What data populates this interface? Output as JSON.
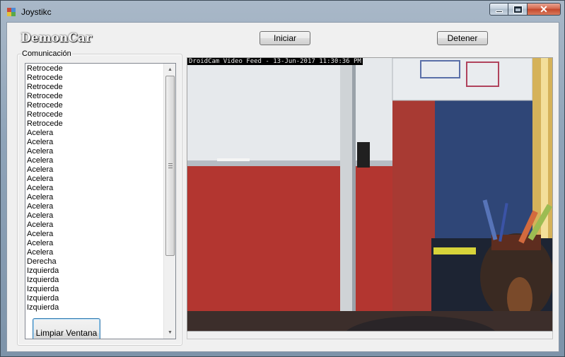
{
  "window": {
    "title": "Joystikc",
    "min_glyph": "min-icon",
    "max_glyph": "max-icon",
    "close_glyph": "✕"
  },
  "header": {
    "brand": "DemonCar",
    "iniciar_label": "Iniciar",
    "detener_label": "Detener"
  },
  "communication": {
    "legend": "Comunicación",
    "items": [
      "Retrocede",
      "Retrocede",
      "Retrocede",
      "Retrocede",
      "Retrocede",
      "Retrocede",
      "Retrocede",
      "Acelera",
      "Acelera",
      "Acelera",
      "Acelera",
      "Acelera",
      "Acelera",
      "Acelera",
      "Acelera",
      "Acelera",
      "Acelera",
      "Acelera",
      "Acelera",
      "Acelera",
      "Acelera",
      "Derecha",
      "Izquierda",
      "Izquierda",
      "Izquierda",
      "Izquierda",
      "Izquierda"
    ],
    "clear_label": "Limpiar Ventana"
  },
  "video": {
    "overlay": "DroidCam Video Feed - 13-Jun-2017 11:30:36 PM"
  },
  "colors": {
    "wall_blue": "#2f4677",
    "wall_red": "#b33630",
    "whiteboard": "#e9ecef",
    "title_gradient_top": "#a9b8c8"
  }
}
